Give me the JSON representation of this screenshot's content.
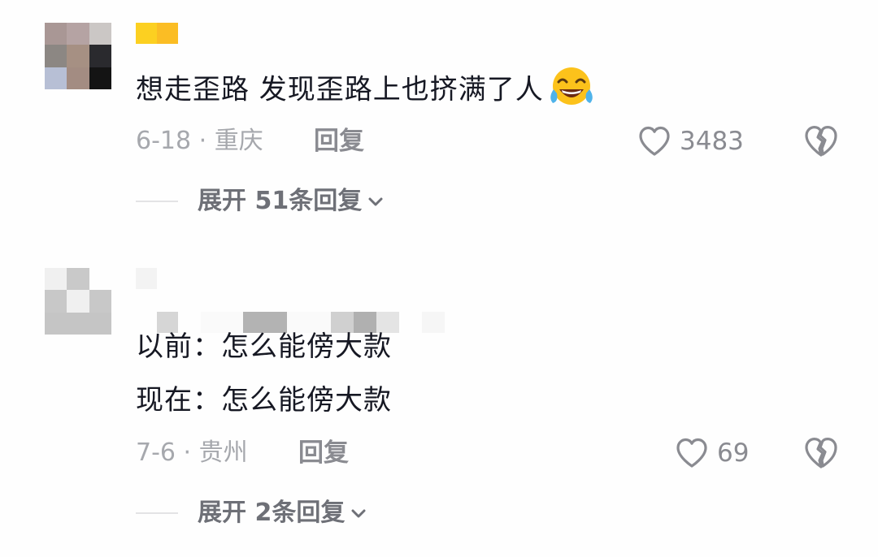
{
  "comments": [
    {
      "text": "想走歪路  发现歪路上也挤满了人",
      "emoji": "tears-of-joy-emoji",
      "date_location": "6-18 · 重庆",
      "reply_label": "回复",
      "likes": "3483",
      "expand_label": "展开 51条回复"
    },
    {
      "lines": [
        "以前：怎么能傍大款",
        "现在：怎么能傍大款"
      ],
      "date_location": "7-6 · 贵州",
      "reply_label": "回复",
      "likes": "69",
      "expand_label": "展开 2条回复"
    }
  ],
  "icons": {
    "like": "heart-outline-icon",
    "dislike": "broken-heart-icon",
    "expand": "chevron-down-icon"
  },
  "colors": {
    "primary_text": "#161823",
    "meta_text": "#a6a8ad",
    "action_text": "#8a8b91",
    "expand_text": "#6e7077",
    "username_redaction": "#fbc02d"
  }
}
